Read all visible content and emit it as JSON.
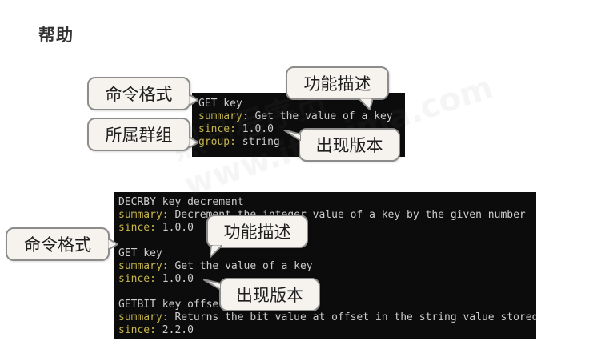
{
  "page": {
    "title": "帮助"
  },
  "terminal_top": {
    "lines": [
      {
        "text": "GET key",
        "highlight": false
      },
      {
        "text": "summary: Get the value of a key",
        "highlight": true
      },
      {
        "text": "since: 1.0.0",
        "highlight": true
      },
      {
        "text": "group: string",
        "highlight": true
      }
    ]
  },
  "terminal_bottom": {
    "lines": [
      {
        "text": "DECRBY key decrement",
        "highlight": false
      },
      {
        "text": "summary: Decrement the integer value of a key by the given number",
        "highlight": true
      },
      {
        "text": "since: 1.0.0",
        "highlight": true
      },
      {
        "text": "",
        "highlight": false
      },
      {
        "text": "GET key",
        "highlight": false
      },
      {
        "text": "summary: Get the value of a key",
        "highlight": true
      },
      {
        "text": "since: 1.0.0",
        "highlight": true
      },
      {
        "text": "",
        "highlight": false
      },
      {
        "text": "GETBIT key offset",
        "highlight": false
      },
      {
        "text": "summary: Returns the bit value at offset in the string value stored at key",
        "highlight": true
      },
      {
        "text": "since: 2.2.0",
        "highlight": true
      }
    ]
  },
  "callouts": {
    "top_format": "命令格式",
    "top_group": "所属群组",
    "top_desc": "功能描述",
    "top_version": "出现版本",
    "bottom_format": "命令格式",
    "bottom_desc": "功能描述",
    "bottom_version": "出现版本"
  },
  "colors": {
    "terminal_bg": "#0c0c0c",
    "terminal_text": "#cccccc",
    "terminal_label": "#c5b54a",
    "callout_bg": "#f6f3ef",
    "callout_border": "#8c8c8c"
  }
}
